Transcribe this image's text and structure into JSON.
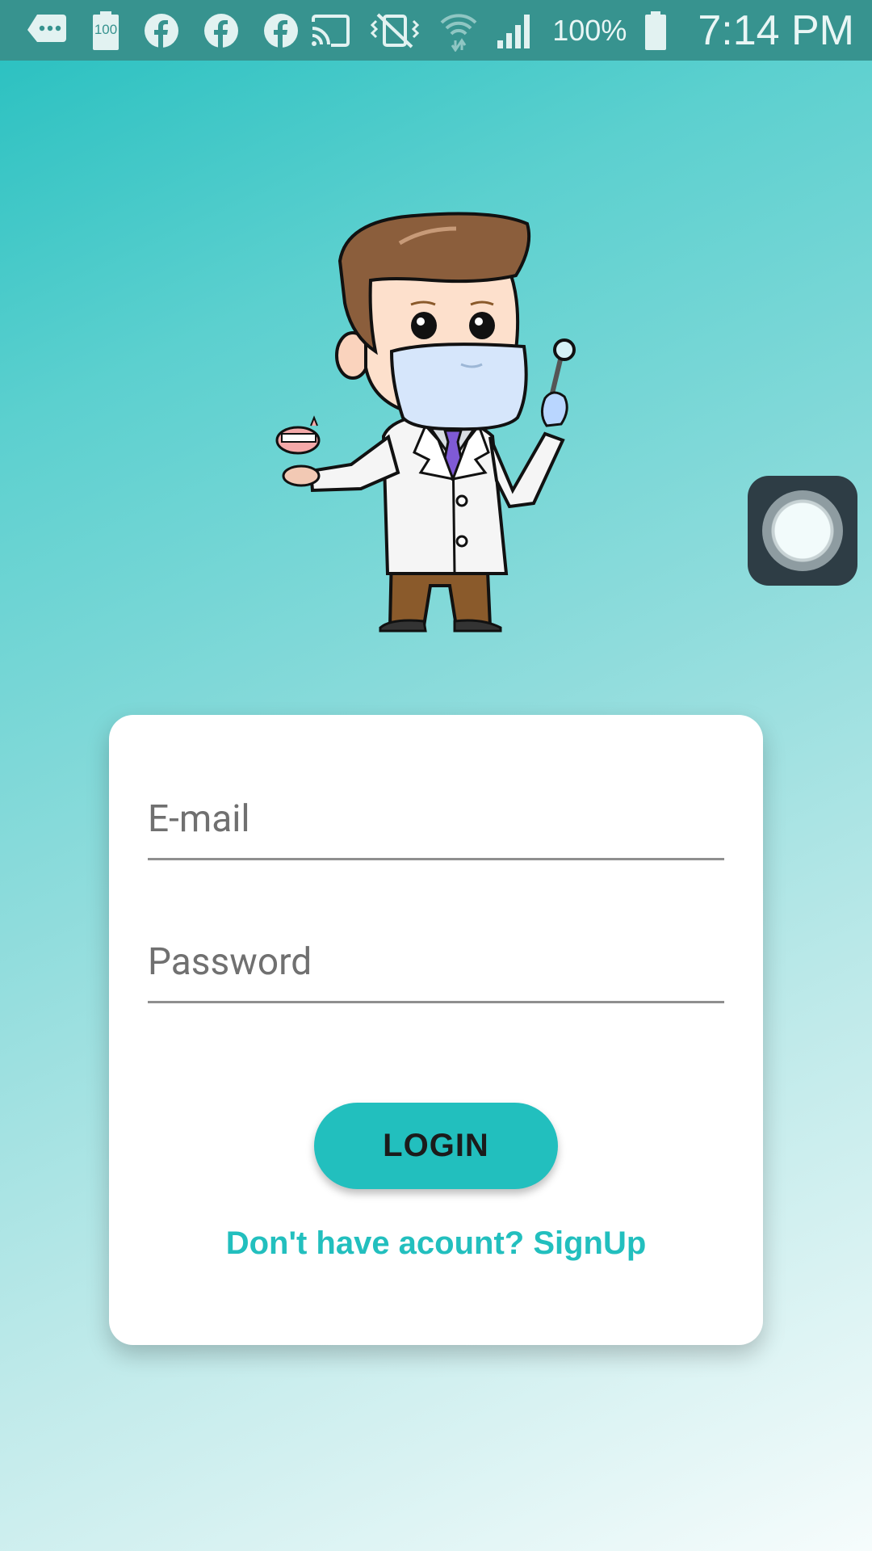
{
  "status_bar": {
    "left_icons": [
      "messages-icon",
      "battery-100-icon",
      "facebook-icon",
      "facebook-icon",
      "facebook-icon"
    ],
    "right_icons": [
      "cast-icon",
      "vibrate-mute-icon",
      "wifi-icon",
      "signal-icon",
      "battery-icon"
    ],
    "battery_small_label": "100",
    "battery_percent": "100%",
    "time": "7:14 PM"
  },
  "login": {
    "email_placeholder": "E-mail",
    "password_placeholder": "Password",
    "login_label": "LOGIN",
    "signup_text": "Don't have acount? SignUp"
  },
  "colors": {
    "accent": "#22bfbe",
    "status_bar": "#37938f",
    "card": "#ffffff"
  }
}
